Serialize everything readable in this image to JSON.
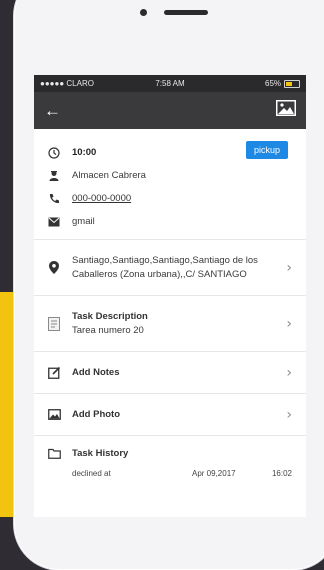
{
  "status_bar": {
    "carrier": "●●●●● CLARO",
    "time": "7:58 AM",
    "battery": "65%"
  },
  "colors": {
    "accent": "#1e88e5",
    "navbar": "#3a3a3c",
    "background_yellow": "#f2c40f"
  },
  "contact": {
    "time": "10:00",
    "name": "Almacen Cabrera",
    "phone": "000-000-0000",
    "email": "gmail",
    "badge": "pickup"
  },
  "address": {
    "text": "Santiago,Santiago,Santiago,Santiago de los Caballeros (Zona urbana),,C/ SANTIAGO"
  },
  "task_description": {
    "title": "Task Description",
    "value": "Tarea numero 20"
  },
  "add_notes": {
    "label": "Add Notes"
  },
  "add_photo": {
    "label": "Add Photo"
  },
  "task_history": {
    "title": "Task History",
    "rows": [
      {
        "status": "declined at",
        "date": "Apr 09,2017",
        "time": "16:02"
      }
    ]
  },
  "icons": {
    "back": "arrow-left-icon",
    "photo": "image-icon",
    "time": "clock-icon",
    "person": "person-icon",
    "phone": "phone-icon",
    "email": "mail-icon",
    "location": "map-pin-icon",
    "description": "document-icon",
    "notes": "edit-icon",
    "photo_add": "image-icon",
    "history": "folder-icon",
    "chevron": "chevron-right-icon"
  }
}
